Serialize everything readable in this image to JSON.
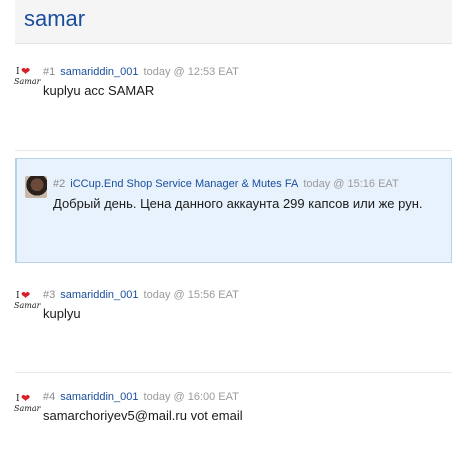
{
  "header": {
    "title": "samar"
  },
  "avatar_logo": {
    "mark": "I",
    "heart": "❤",
    "word": "Samar"
  },
  "posts": [
    {
      "number": "#1",
      "author": "samariddin_001",
      "time": "today @ 12:53 EAT",
      "text": "kuplyu acc SAMAR"
    },
    {
      "number": "#2",
      "author": "iCCup.End  Shop Service Manager & Mutes FA",
      "time": "today @ 15:16 EAT",
      "text": "Добрый день. Цена данного аккаунта 299 капсов или же рун."
    },
    {
      "number": "#3",
      "author": "samariddin_001",
      "time": "today @ 15:56 EAT",
      "text": "kuplyu"
    },
    {
      "number": "#4",
      "author": "samariddin_001",
      "time": "today @ 16:00 EAT",
      "text": "samarchoriyev5@mail.ru vot email"
    }
  ],
  "colors": {
    "link": "#1a4e9c",
    "highlight_bg": "#e8f2fc",
    "heart": "#d9202a"
  }
}
